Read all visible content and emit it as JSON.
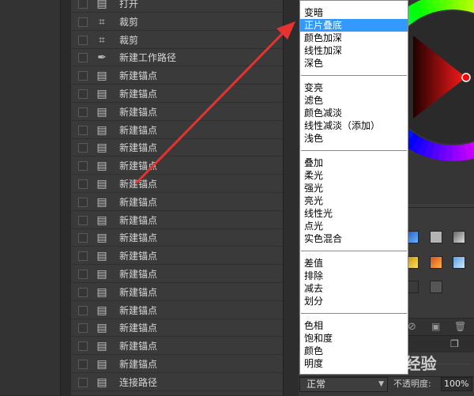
{
  "history": {
    "items": [
      {
        "label": "打开",
        "icon": "doc-icon"
      },
      {
        "label": "裁剪",
        "icon": "crop-icon"
      },
      {
        "label": "裁剪",
        "icon": "crop-icon"
      },
      {
        "label": "新建工作路径",
        "icon": "pen-icon"
      },
      {
        "label": "新建锚点",
        "icon": "doc-icon"
      },
      {
        "label": "新建锚点",
        "icon": "doc-icon"
      },
      {
        "label": "新建锚点",
        "icon": "doc-icon"
      },
      {
        "label": "新建锚点",
        "icon": "doc-icon"
      },
      {
        "label": "新建锚点",
        "icon": "doc-icon"
      },
      {
        "label": "新建锚点",
        "icon": "doc-icon"
      },
      {
        "label": "新建锚点",
        "icon": "doc-icon"
      },
      {
        "label": "新建锚点",
        "icon": "doc-icon"
      },
      {
        "label": "新建锚点",
        "icon": "doc-icon"
      },
      {
        "label": "新建锚点",
        "icon": "doc-icon"
      },
      {
        "label": "新建锚点",
        "icon": "doc-icon"
      },
      {
        "label": "新建锚点",
        "icon": "doc-icon"
      },
      {
        "label": "新建锚点",
        "icon": "doc-icon"
      },
      {
        "label": "新建锚点",
        "icon": "doc-icon"
      },
      {
        "label": "新建锚点",
        "icon": "doc-icon"
      },
      {
        "label": "新建锚点",
        "icon": "doc-icon"
      },
      {
        "label": "新建锚点",
        "icon": "doc-icon"
      },
      {
        "label": "连接路径",
        "icon": "doc-icon"
      }
    ]
  },
  "blend_menu": {
    "groups": [
      [
        "变暗",
        "正片叠底",
        "颜色加深",
        "线性加深",
        "深色"
      ],
      [
        "变亮",
        "滤色",
        "颜色减淡",
        "线性减淡（添加）",
        "浅色"
      ],
      [
        "叠加",
        "柔光",
        "强光",
        "亮光",
        "线性光",
        "点光",
        "实色混合"
      ],
      [
        "差值",
        "排除",
        "减去",
        "划分"
      ],
      [
        "色相",
        "饱和度",
        "颜色",
        "明度"
      ]
    ],
    "selected": "正片叠底"
  },
  "layers": {
    "blend_mode_value": "正常",
    "opacity_label": "不透明度:",
    "opacity_value": "100%"
  },
  "watermark": {
    "text": "Bai 经验"
  },
  "colors": {
    "selection": "#3399ff",
    "arrow": "#e8322f",
    "panel_bg": "#3a3a3a"
  }
}
